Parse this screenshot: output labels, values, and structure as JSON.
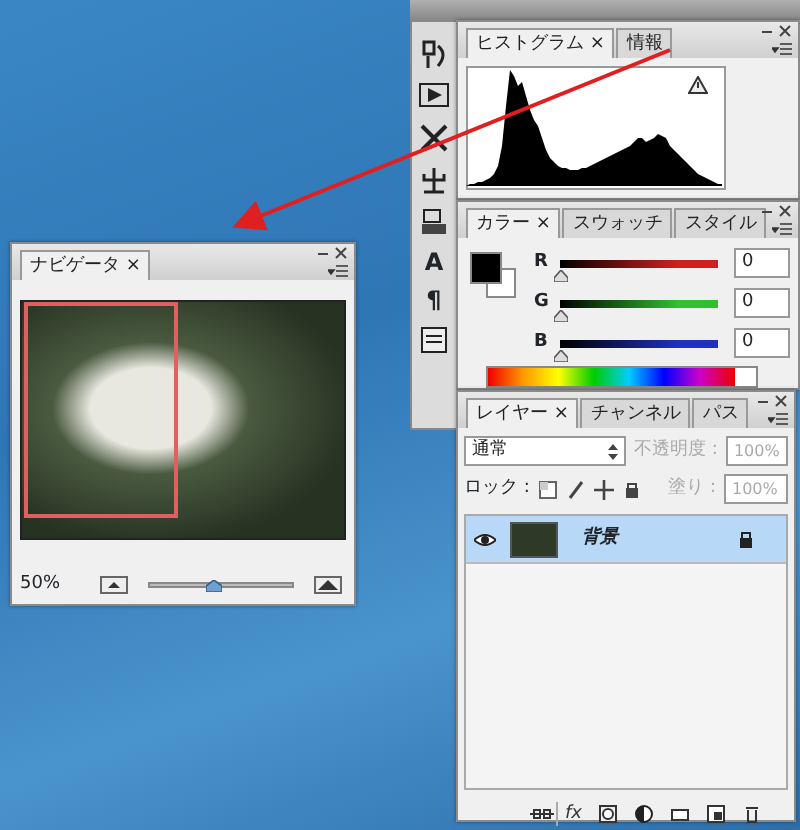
{
  "dock": {
    "glyphs": [
      "A",
      "¶"
    ]
  },
  "histogram_panel": {
    "tabs": [
      {
        "label": "ヒストグラム",
        "selected": true,
        "close": "×"
      },
      {
        "label": "情報",
        "selected": false
      }
    ]
  },
  "color_panel": {
    "tabs": [
      {
        "label": "カラー",
        "selected": true,
        "close": "×"
      },
      {
        "label": "スウォッチ",
        "selected": false
      },
      {
        "label": "スタイル",
        "selected": false
      }
    ],
    "channels": [
      {
        "label": "R",
        "value": "0",
        "level": 0,
        "color": "#d02020"
      },
      {
        "label": "G",
        "value": "0",
        "level": 0,
        "color": "#30c030"
      },
      {
        "label": "B",
        "value": "0",
        "level": 0,
        "color": "#2030c0"
      }
    ]
  },
  "layers_panel": {
    "tabs": [
      {
        "label": "レイヤー",
        "selected": true,
        "close": "×"
      },
      {
        "label": "チャンネル",
        "selected": false
      },
      {
        "label": "パス",
        "selected": false
      }
    ],
    "blend_mode": "通常",
    "opacity_label": "不透明度 :",
    "opacity": "100%",
    "opacity_disabled": true,
    "lock_label": "ロック :",
    "fill_label": "塗り :",
    "fill": "100%",
    "fill_disabled": true,
    "layers": [
      {
        "name": "背景",
        "selected": true,
        "visible": true,
        "locked": true
      }
    ],
    "fx": "fx"
  },
  "navigator_panel": {
    "tabs": [
      {
        "label": "ナビゲータ",
        "selected": true,
        "close": "×"
      }
    ],
    "zoom": "50%",
    "zoom_slider": {
      "level": 0.45
    }
  }
}
